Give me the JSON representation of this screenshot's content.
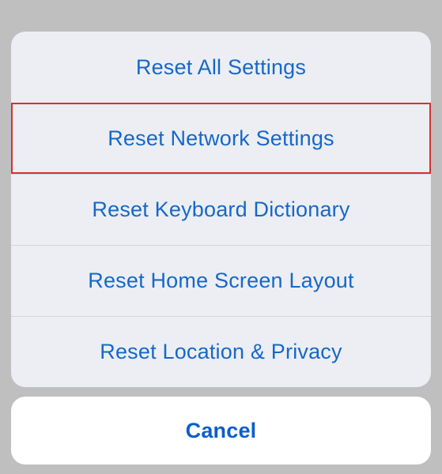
{
  "action_sheet": {
    "options": [
      {
        "label": "Reset All Settings",
        "highlighted": false
      },
      {
        "label": "Reset Network Settings",
        "highlighted": true
      },
      {
        "label": "Reset Keyboard Dictionary",
        "highlighted": false
      },
      {
        "label": "Reset Home Screen Layout",
        "highlighted": false
      },
      {
        "label": "Reset Location & Privacy",
        "highlighted": false
      }
    ],
    "cancel_label": "Cancel"
  }
}
